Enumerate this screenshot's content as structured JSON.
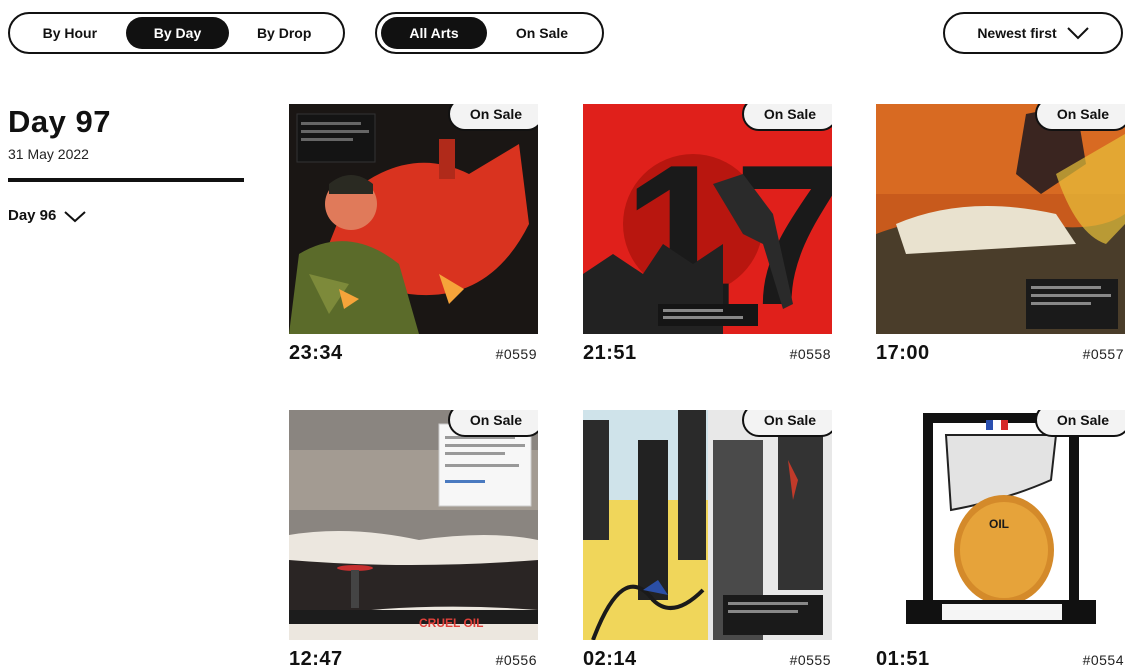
{
  "filters": {
    "time_tabs": [
      {
        "label": "By Hour",
        "active": false
      },
      {
        "label": "By Day",
        "active": true
      },
      {
        "label": "By Drop",
        "active": false
      }
    ],
    "art_tabs": [
      {
        "label": "All Arts",
        "active": true
      },
      {
        "label": "On Sale",
        "active": false
      }
    ],
    "sort_label": "Newest first"
  },
  "sidebar": {
    "day_title": "Day 97",
    "day_date": "31 May 2022",
    "prev_day_label": "Day 96"
  },
  "cards": [
    {
      "time": "23:34",
      "number": "#0559",
      "badge": "On Sale"
    },
    {
      "time": "21:51",
      "number": "#0558",
      "badge": "On Sale"
    },
    {
      "time": "17:00",
      "number": "#0557",
      "badge": "On Sale"
    },
    {
      "time": "12:47",
      "number": "#0556",
      "badge": "On Sale",
      "art_caption": "CRUEL OIL"
    },
    {
      "time": "02:14",
      "number": "#0555",
      "badge": "On Sale"
    },
    {
      "time": "01:51",
      "number": "#0554",
      "badge": "On Sale",
      "art_caption": "OIL"
    }
  ],
  "art_artwork": {
    "card2_numerals": "17"
  },
  "colors": {
    "ink": "#111111",
    "badge_bg": "#f3f3f3",
    "accent_red": "#e0201b"
  },
  "icons": {
    "sort_chevron": "chevron-down-icon",
    "day_chevron": "chevron-down-icon"
  }
}
